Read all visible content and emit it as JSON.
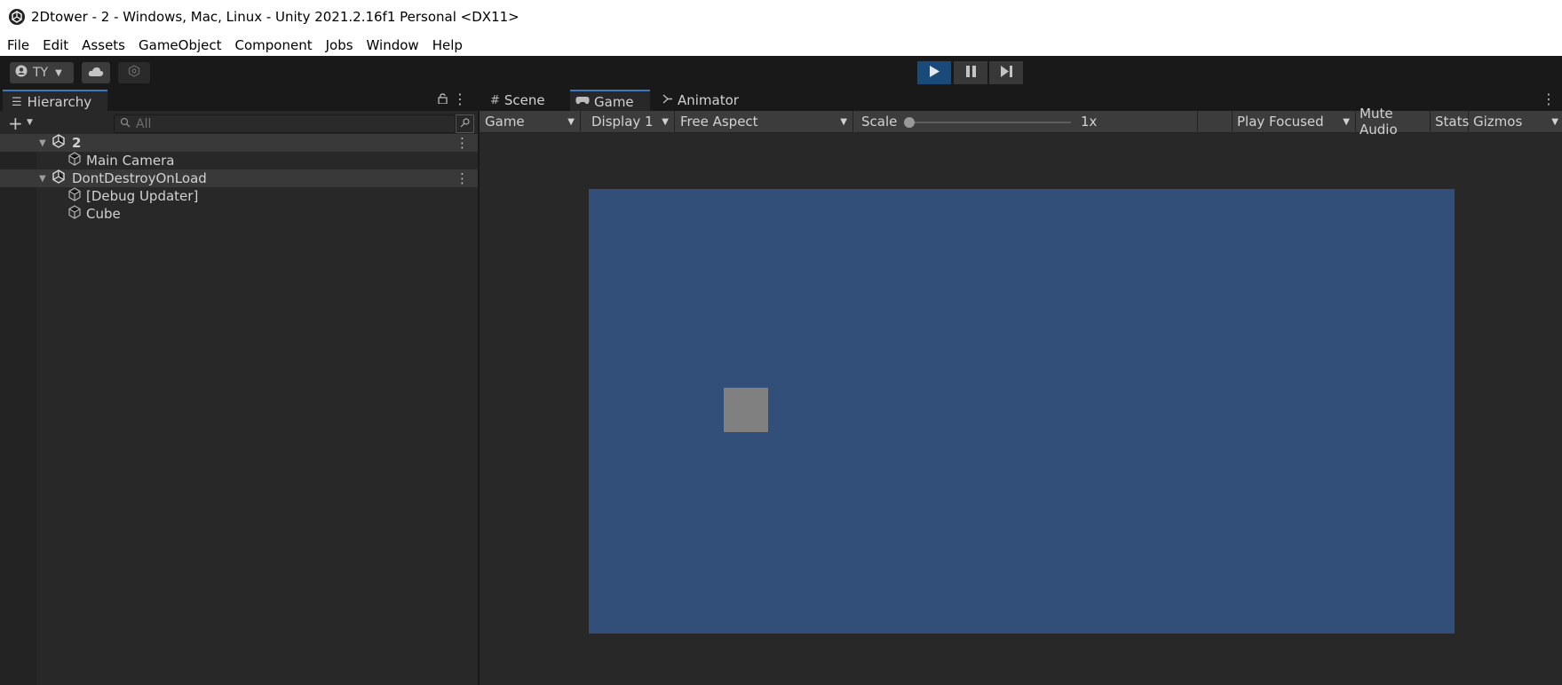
{
  "window": {
    "title": "2Dtower - 2 - Windows, Mac, Linux - Unity 2021.2.16f1 Personal <DX11>"
  },
  "menu": [
    "File",
    "Edit",
    "Assets",
    "GameObject",
    "Component",
    "Jobs",
    "Window",
    "Help"
  ],
  "toolbar": {
    "account_label": "TY",
    "play_icon": "play-icon",
    "pause_icon": "pause-icon",
    "step_icon": "step-icon"
  },
  "hierarchy": {
    "tab_label": "Hierarchy",
    "search_placeholder": "All",
    "items": [
      {
        "label": "2"
      },
      {
        "label": "Main Camera"
      },
      {
        "label": "DontDestroyOnLoad"
      },
      {
        "label": "[Debug Updater]"
      },
      {
        "label": "Cube"
      }
    ]
  },
  "gamepanel": {
    "tabs": [
      "Scene",
      "Game",
      "Animator"
    ],
    "toolbar": {
      "game_dropdown": "Game",
      "display_dropdown": "Display 1",
      "aspect_dropdown": "Free Aspect",
      "scale_label": "Scale",
      "scale_value": "1x",
      "play_focused": "Play Focused",
      "mute_audio": "Mute Audio",
      "stats": "Stats",
      "gizmos": "Gizmos"
    }
  },
  "colors": {
    "viewport_bg": "#314f79",
    "cube": "#808080",
    "accent": "#3a79bb"
  }
}
